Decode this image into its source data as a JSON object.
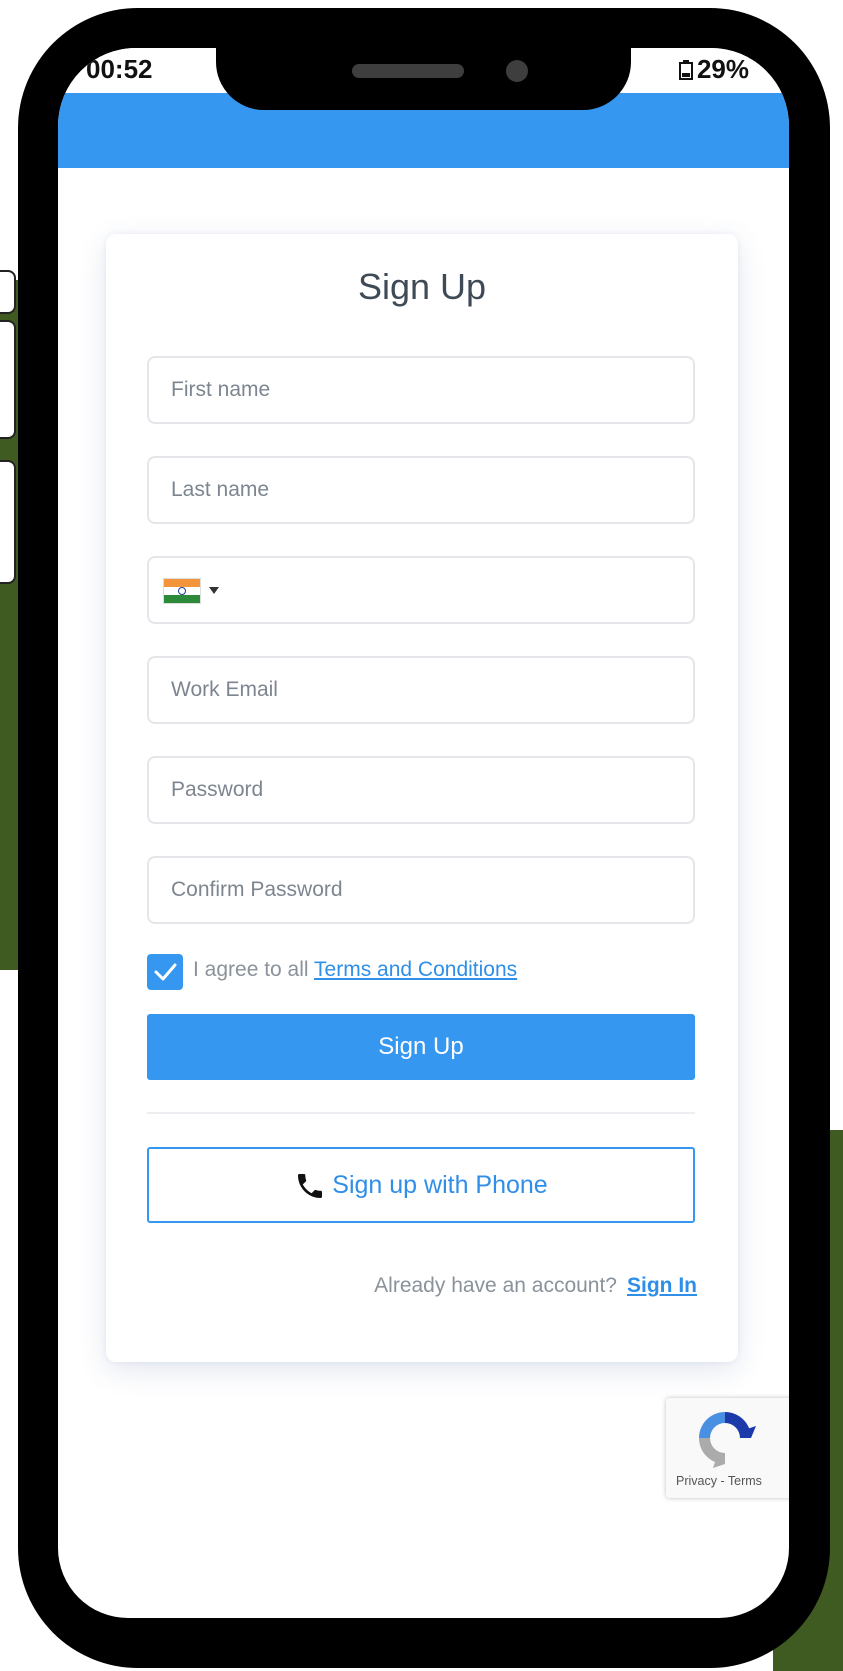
{
  "status_bar": {
    "time": "00:52",
    "battery": "29%"
  },
  "form": {
    "title": "Sign Up",
    "first_name_placeholder": "First name",
    "last_name_placeholder": "Last name",
    "phone_country": "India",
    "work_email_placeholder": "Work Email",
    "password_placeholder": "Password",
    "confirm_password_placeholder": "Confirm Password",
    "agree_checked": true,
    "agree_prefix": "I agree to all",
    "agree_link": "Terms and Conditions",
    "submit_label": "Sign Up",
    "phone_signup_label": "Sign up with Phone",
    "signin_prompt": "Already have an account?",
    "signin_link": "Sign In"
  },
  "recaptcha": {
    "privacy": "Privacy",
    "separator": "-",
    "terms": "Terms"
  },
  "colors": {
    "accent": "#3597f0",
    "link": "#2f8fe8",
    "background_green": "#3f5b21"
  },
  "icons": {
    "phone": "phone-icon",
    "check": "checkmark-icon",
    "recaptcha": "recaptcha-logo"
  }
}
